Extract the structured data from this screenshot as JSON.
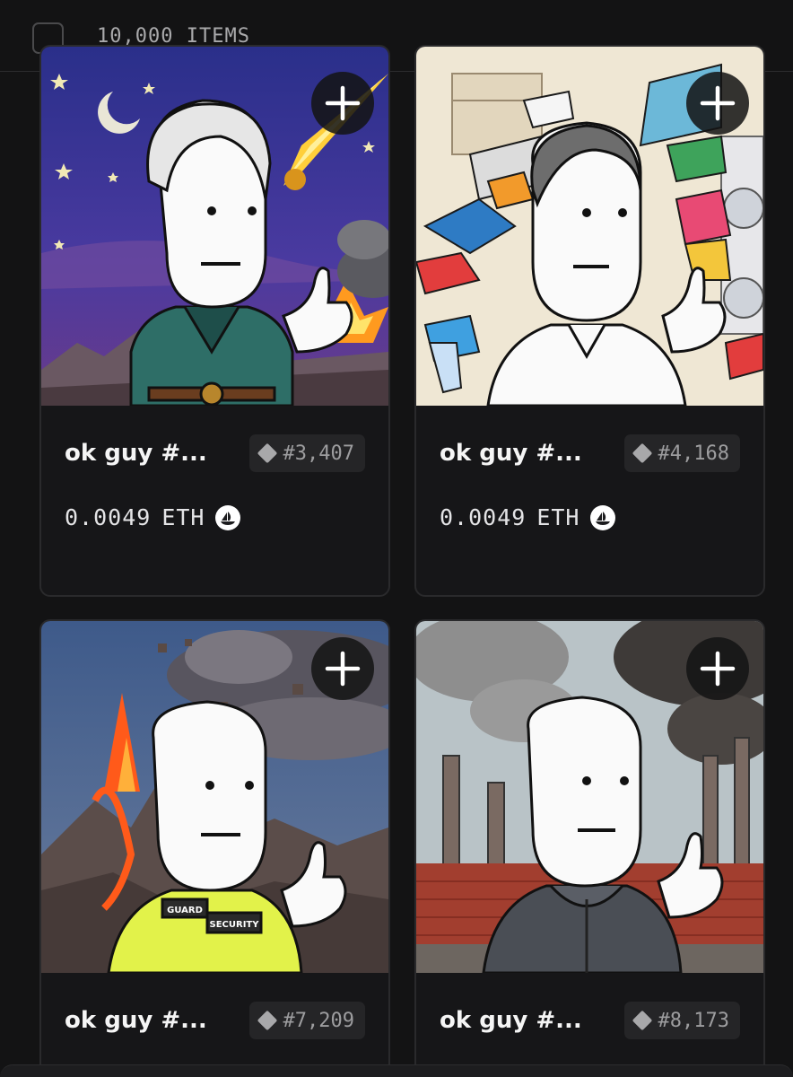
{
  "header": {
    "item_count": "10,000 ITEMS"
  },
  "cards": [
    {
      "name": "ok guy #...",
      "token_id": "#3,407",
      "price": "0.0049",
      "currency": "ETH",
      "scene": "night-sky-meteor",
      "icon": "plus-icon"
    },
    {
      "name": "ok guy #...",
      "token_id": "#4,168",
      "price": "0.0049",
      "currency": "ETH",
      "scene": "laundry-room",
      "icon": "plus-icon"
    },
    {
      "name": "ok guy #...",
      "token_id": "#7,209",
      "scene": "volcano-eruption",
      "icon": "plus-icon"
    },
    {
      "name": "ok guy #...",
      "token_id": "#8,173",
      "scene": "factory-smoke",
      "icon": "plus-icon"
    }
  ],
  "art_labels": {
    "guard": "GUARD",
    "security": "SECURITY"
  },
  "colors": {
    "background": "#131314",
    "card": "#161618",
    "token_bg": "#252527",
    "text": "#f5f5f5",
    "muted": "#9d9d9f"
  }
}
